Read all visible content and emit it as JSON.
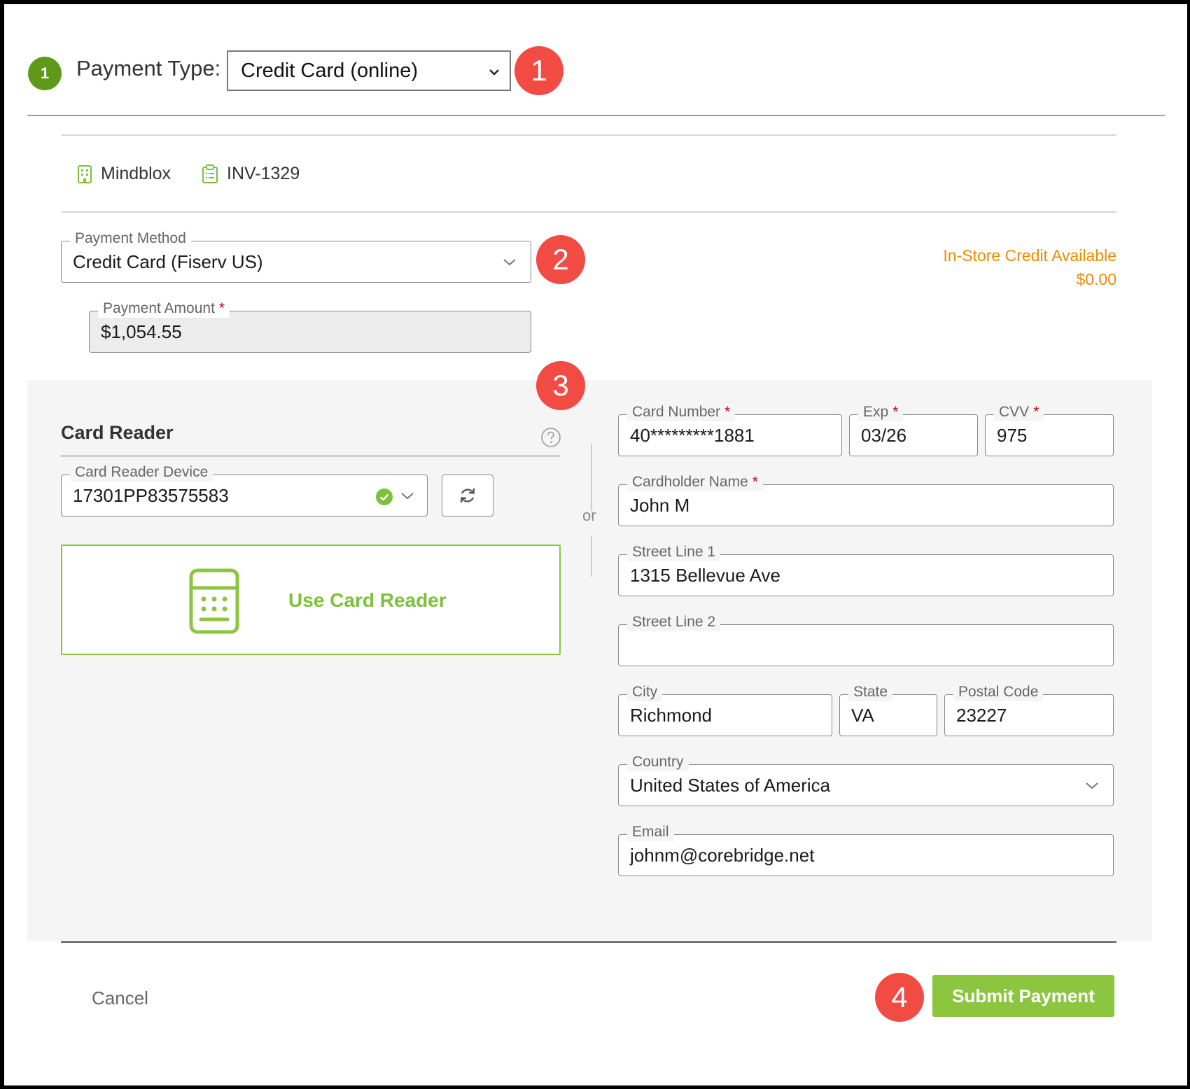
{
  "top": {
    "step_number": "1",
    "payment_type_label": "Payment Type:",
    "payment_type_value": "Credit Card (online)"
  },
  "callouts": {
    "c1": "1",
    "c2": "2",
    "c3": "3",
    "c4": "4"
  },
  "context": {
    "company": "Mindblox",
    "company_icon": "building-icon",
    "invoice": "INV-1329",
    "invoice_icon": "clipboard-icon"
  },
  "payment_method": {
    "label": "Payment Method",
    "value": "Credit Card (Fiserv US)"
  },
  "payment_amount": {
    "label": "Payment Amount",
    "required": "*",
    "value": "$1,054.55"
  },
  "store_credit": {
    "label": "In-Store Credit Available",
    "amount": "$0.00",
    "color": "#f08a00"
  },
  "card_reader": {
    "title": "Card Reader",
    "help_icon": "question-circle-icon",
    "device_label": "Card Reader Device",
    "device_value": "17301PP83575583",
    "refresh_icon": "refresh-icon",
    "use_button": "Use Card Reader",
    "reader_icon": "card-terminal-icon",
    "accent": "#7dc13a"
  },
  "divider_text": "or",
  "card_form": {
    "card_number": {
      "label": "Card Number",
      "required": "*",
      "value": "40*********1881"
    },
    "exp": {
      "label": "Exp",
      "required": "*",
      "value": "03/26"
    },
    "cvv": {
      "label": "CVV",
      "required": "*",
      "value": "975"
    },
    "cardholder": {
      "label": "Cardholder Name",
      "required": "*",
      "value": "John M"
    },
    "street1": {
      "label": "Street Line 1",
      "value": "1315 Bellevue Ave"
    },
    "street2": {
      "label": "Street Line 2",
      "value": ""
    },
    "city": {
      "label": "City",
      "value": "Richmond"
    },
    "state": {
      "label": "State",
      "value": "VA"
    },
    "postal": {
      "label": "Postal Code",
      "value": "23227"
    },
    "country": {
      "label": "Country",
      "value": "United States of America"
    },
    "email": {
      "label": "Email",
      "value": "johnm@corebridge.net"
    }
  },
  "footer": {
    "cancel": "Cancel",
    "submit": "Submit Payment",
    "submit_color": "#8cc63f"
  }
}
